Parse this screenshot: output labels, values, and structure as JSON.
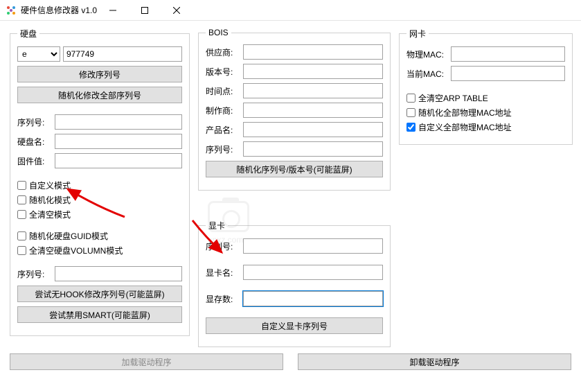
{
  "window": {
    "title": "硬件信息修改器 v1.0"
  },
  "disk": {
    "legend": "硬盘",
    "drive_value": "e",
    "serial_input": "977749",
    "btn_modify_serial": "修改序列号",
    "btn_random_all_serial": "随机化修改全部序列号",
    "label_serial": "序列号:",
    "label_diskname": "硬盘名:",
    "label_firmware": "固件值:",
    "val_serial": "",
    "val_diskname": "",
    "val_firmware": "",
    "chk_custom_mode": "自定义模式",
    "chk_random_mode": "随机化模式",
    "chk_clear_mode": "全清空模式",
    "chk_random_guid": "随机化硬盘GUID模式",
    "chk_clear_volumn": "全清空硬盘VOLUMN模式",
    "label_serial2": "序列号:",
    "val_serial2": "",
    "btn_nohook": "尝试无HOOK修改序列号(可能蓝屏)",
    "btn_disable_smart": "尝试禁用SMART(可能蓝屏)"
  },
  "bios": {
    "legend": "BOIS",
    "label_vendor": "供应商:",
    "label_version": "版本号:",
    "label_time": "时间点:",
    "label_maker": "制作商:",
    "label_product": "产品名:",
    "label_serial": "序列号:",
    "val_vendor": "",
    "val_version": "",
    "val_time": "",
    "val_maker": "",
    "val_product": "",
    "val_serial": "",
    "btn_random": "随机化序列号/版本号(可能蓝屏)"
  },
  "gpu": {
    "legend": "显卡",
    "label_serial": "序列号:",
    "label_name": "显卡名:",
    "label_memcount": "显存数:",
    "val_serial": "",
    "val_name": "",
    "val_memcount": "",
    "btn_custom": "自定义显卡序列号"
  },
  "nic": {
    "legend": "网卡",
    "label_phys_mac": "物理MAC:",
    "label_curr_mac": "当前MAC:",
    "val_phys_mac": "",
    "val_curr_mac": "",
    "chk_clear_arp": "全清空ARP TABLE",
    "chk_random_mac": "随机化全部物理MAC地址",
    "chk_custom_mac": "自定义全部物理MAC地址"
  },
  "bottom": {
    "btn_load_driver": "加载驱动程序",
    "btn_unload_driver": "卸载驱动程序"
  },
  "watermark": "anxz.com"
}
